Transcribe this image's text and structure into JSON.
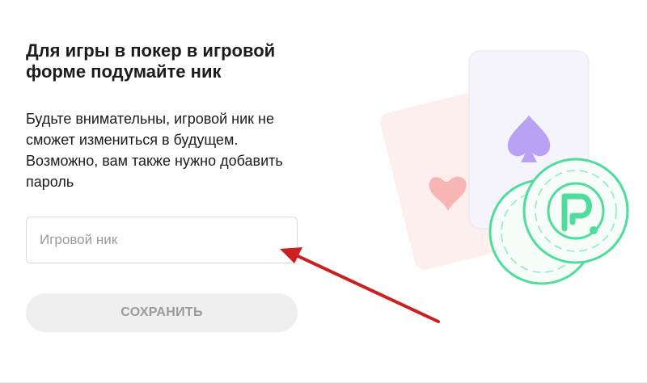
{
  "form": {
    "title": "Для игры в покер в игровой форме подумайте ник",
    "description": "Будьте внимательны, игровой ник не сможет измениться в будущем. Возможно, вам также нужно добавить пароль",
    "nick_input": {
      "placeholder": "Игровой ник",
      "value": ""
    },
    "save_button_label": "СОХРАНИТЬ"
  },
  "illustration": {
    "icons": [
      "heart-card-icon",
      "spade-card-icon",
      "poker-chip-icon"
    ],
    "colors": {
      "heart_card": "#fdecea",
      "heart": "#f4a3a0",
      "spade_card": "#f4f3fb",
      "spade": "#b9a2f4",
      "chip": "#4fdc9c",
      "arrow": "#cc1f1f"
    }
  }
}
